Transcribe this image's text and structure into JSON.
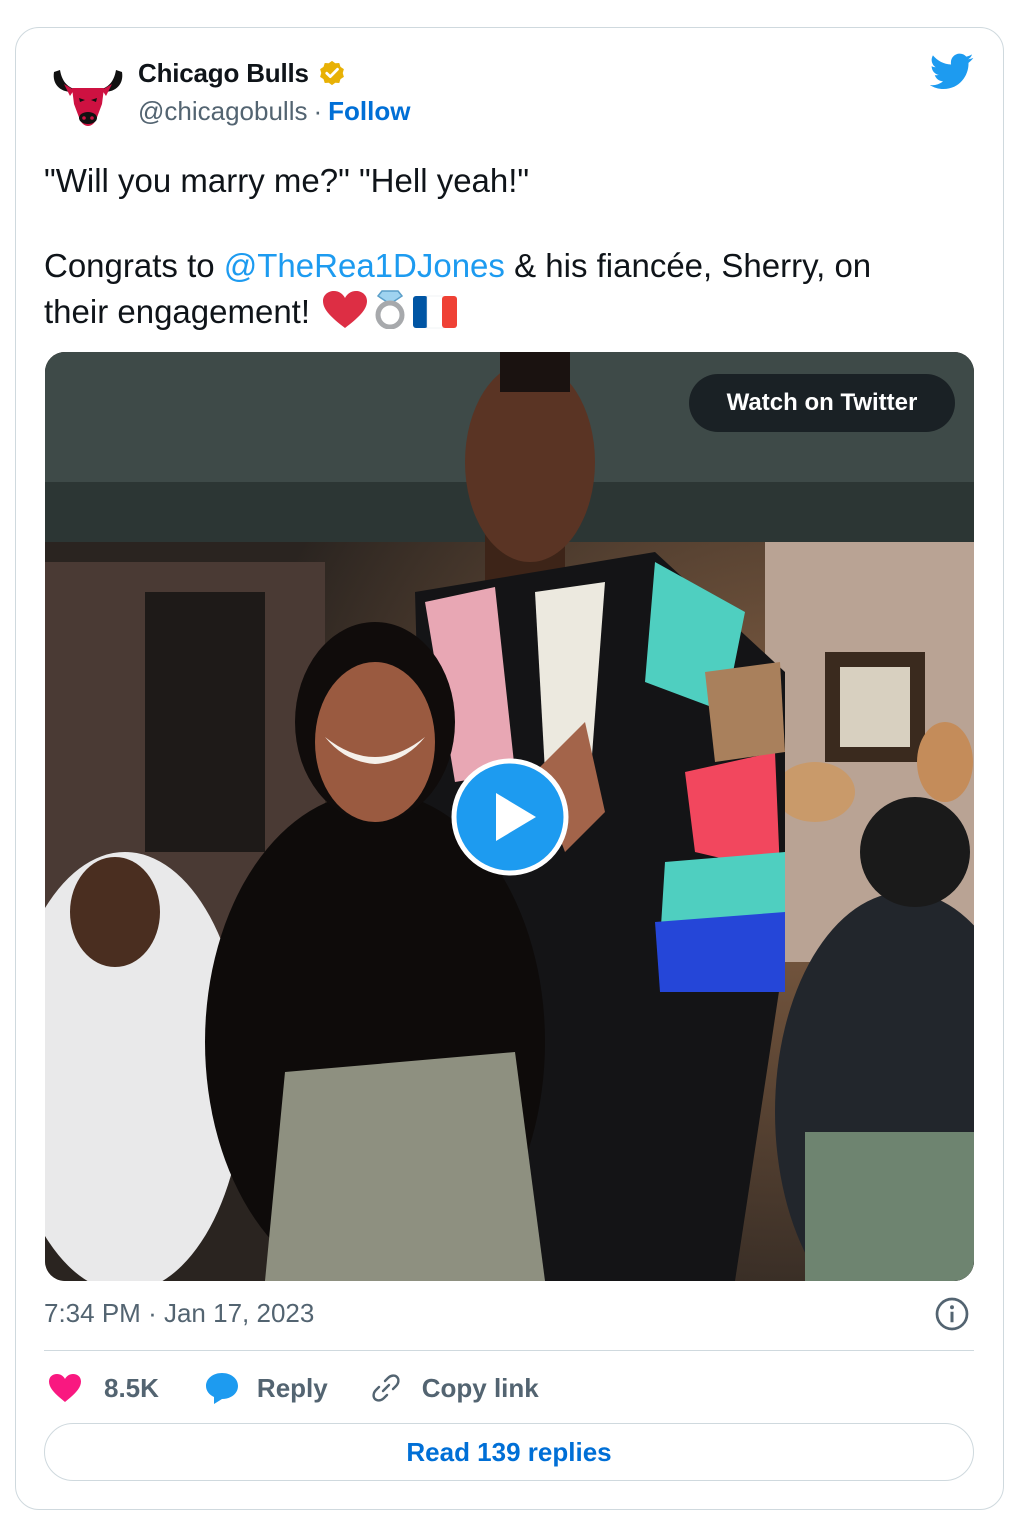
{
  "account": {
    "name": "Chicago Bulls",
    "handle": "@chicagobulls",
    "separator": "·",
    "follow_label": "Follow",
    "verified_color": "#e8b105"
  },
  "tweet": {
    "line1": "\"Will you marry me?\" \"Hell yeah!\"",
    "line2_prefix": "Congrats to ",
    "mention": "@TheRea1DJones",
    "line2_suffix": " & his fiancée, Sherry, on",
    "line3": "their engagement!",
    "emojis": [
      "heart-emoji",
      "ring-emoji",
      "france-flag-emoji"
    ]
  },
  "media": {
    "watch_label": "Watch on Twitter",
    "play_icon": "play-icon"
  },
  "meta": {
    "time": "7:34 PM",
    "separator": "·",
    "date": "Jan 17, 2023"
  },
  "actions": {
    "likes": "8.5K",
    "reply_label": "Reply",
    "copy_label": "Copy link"
  },
  "footer": {
    "read_replies_label": "Read 139 replies"
  },
  "colors": {
    "accent": "#1d9bf0",
    "link_blue": "#006fd6",
    "like_pink": "#f91880",
    "muted": "#536471",
    "border": "#cfd9de"
  }
}
